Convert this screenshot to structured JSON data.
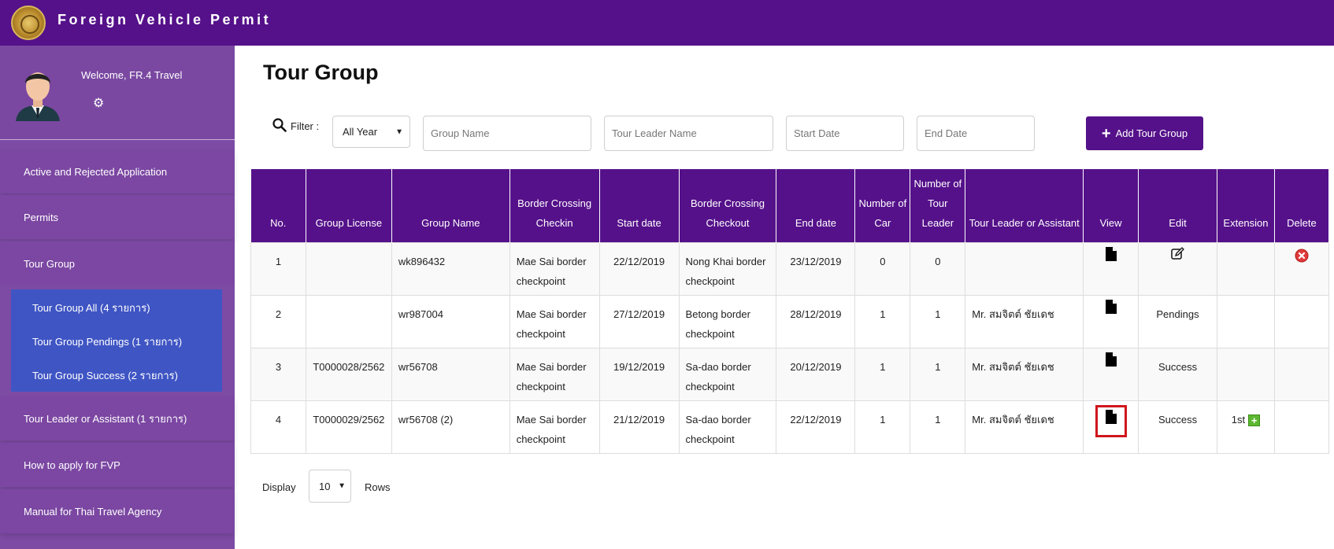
{
  "app": {
    "title": "Foreign Vehicle Permit"
  },
  "profile": {
    "welcome": "Welcome, FR.4 Travel"
  },
  "sidebar": {
    "items": [
      {
        "label": "Active and Rejected Application"
      },
      {
        "label": "Permits"
      },
      {
        "label": "Tour Group"
      },
      {
        "label": "Tour Leader or Assistant (1 รายการ)"
      },
      {
        "label": "How to apply for FVP"
      },
      {
        "label": "Manual for Thai Travel Agency"
      }
    ],
    "submenu": [
      {
        "label": "Tour Group All (4 รายการ)"
      },
      {
        "label": "Tour Group Pendings (1 รายการ)"
      },
      {
        "label": "Tour Group Success (2 รายการ)"
      }
    ]
  },
  "main": {
    "title": "Tour Group",
    "filter": {
      "label": "Filter :",
      "year": "All Year",
      "group_name_placeholder": "Group Name",
      "tour_leader_placeholder": "Tour Leader Name",
      "start_date_placeholder": "Start Date",
      "end_date_placeholder": "End Date"
    },
    "add_button": "Add Tour Group",
    "table": {
      "headers": [
        "No.",
        "Group License",
        "Group Name",
        "Border Crossing Checkin",
        "Start date",
        "Border Crossing Checkout",
        "End date",
        "Number of Car",
        "Number of Tour Leader",
        "Tour Leader or Assistant",
        "View",
        "Edit",
        "Extension",
        "Delete"
      ],
      "rows": [
        {
          "no": "1",
          "license": "",
          "group": "wk896432",
          "checkin": "Mae Sai border checkpoint",
          "start": "22/12/2019",
          "checkout": "Nong Khai border checkpoint",
          "end": "23/12/2019",
          "cars": "0",
          "leaders": "0",
          "assistant": "",
          "edit": "",
          "extension": ""
        },
        {
          "no": "2",
          "license": "",
          "group": "wr987004",
          "checkin": "Mae Sai border checkpoint",
          "start": "27/12/2019",
          "checkout": "Betong border checkpoint",
          "end": "28/12/2019",
          "cars": "1",
          "leaders": "1",
          "assistant": "Mr. สมจิตต์ ชัยเดช",
          "edit": "Pendings",
          "extension": ""
        },
        {
          "no": "3",
          "license": "T0000028/2562",
          "group": "wr56708",
          "checkin": "Mae Sai border checkpoint",
          "start": "19/12/2019",
          "checkout": "Sa-dao border checkpoint",
          "end": "20/12/2019",
          "cars": "1",
          "leaders": "1",
          "assistant": "Mr. สมจิตต์ ชัยเดช",
          "edit": "Success",
          "extension": ""
        },
        {
          "no": "4",
          "license": "T0000029/2562",
          "group": "wr56708 (2)",
          "checkin": "Mae Sai border checkpoint",
          "start": "21/12/2019",
          "checkout": "Sa-dao border checkpoint",
          "end": "22/12/2019",
          "cars": "1",
          "leaders": "1",
          "assistant": "Mr. สมจิตต์ ชัยเดช",
          "edit": "Success",
          "extension": "1st"
        }
      ]
    },
    "pagination": {
      "display_label": "Display",
      "rows_value": "10",
      "rows_label": "Rows"
    }
  },
  "icons": {
    "view": "document-icon",
    "edit": "edit-icon",
    "delete": "delete-icon",
    "extension_add": "plus-square-icon",
    "search": "search-icon",
    "settings": "gear-icon"
  },
  "colors": {
    "brand_purple": "#55118a",
    "sidebar_purple": "#7d4ba4",
    "submenu_blue": "#3f55c4",
    "highlight_red": "#d0161c",
    "delete_red": "#e03a3a",
    "extension_green": "#5cb82f"
  }
}
